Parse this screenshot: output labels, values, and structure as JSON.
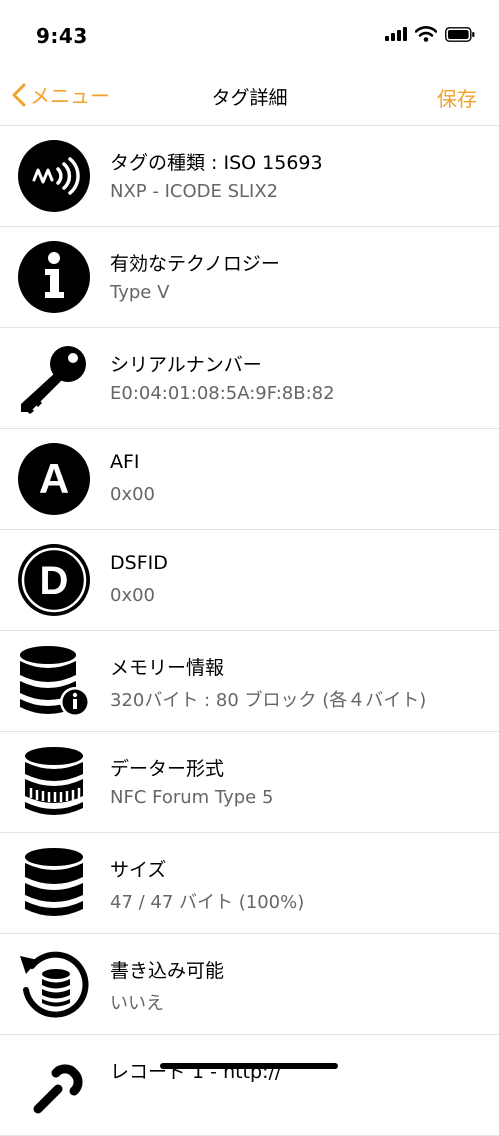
{
  "status_bar": {
    "time": "9:43"
  },
  "nav": {
    "back_label": "メニュー",
    "title": "タグ詳細",
    "save_label": "保存"
  },
  "colors": {
    "accent": "#f2a22b",
    "secondary_text": "#666666",
    "separator": "#e3e3e3"
  },
  "rows": [
    {
      "icon": "nfc-signal-icon",
      "title": "タグの種類 : ISO 15693",
      "value": "NXP - ICODE SLIX2"
    },
    {
      "icon": "info-icon",
      "title": "有効なテクノロジー",
      "value": "Type V"
    },
    {
      "icon": "key-icon",
      "title": "シリアルナンバー",
      "value": "E0:04:01:08:5A:9F:8B:82"
    },
    {
      "icon": "letter-a-icon",
      "title": "AFI",
      "value": "0x00"
    },
    {
      "icon": "letter-d-icon",
      "title": "DSFID",
      "value": "0x00"
    },
    {
      "icon": "database-info-icon",
      "title": "メモリー情報",
      "value": "320バイト : 80 ブロック (各４バイト)"
    },
    {
      "icon": "database-format-icon",
      "title": "データー形式",
      "value": "NFC Forum Type 5"
    },
    {
      "icon": "database-icon",
      "title": "サイズ",
      "value": "47 / 47 バイト (100%)"
    },
    {
      "icon": "database-refresh-icon",
      "title": "書き込み可能",
      "value": "いいえ"
    },
    {
      "icon": "link-icon",
      "title": "レコード 1 - http://",
      "value": ""
    }
  ]
}
